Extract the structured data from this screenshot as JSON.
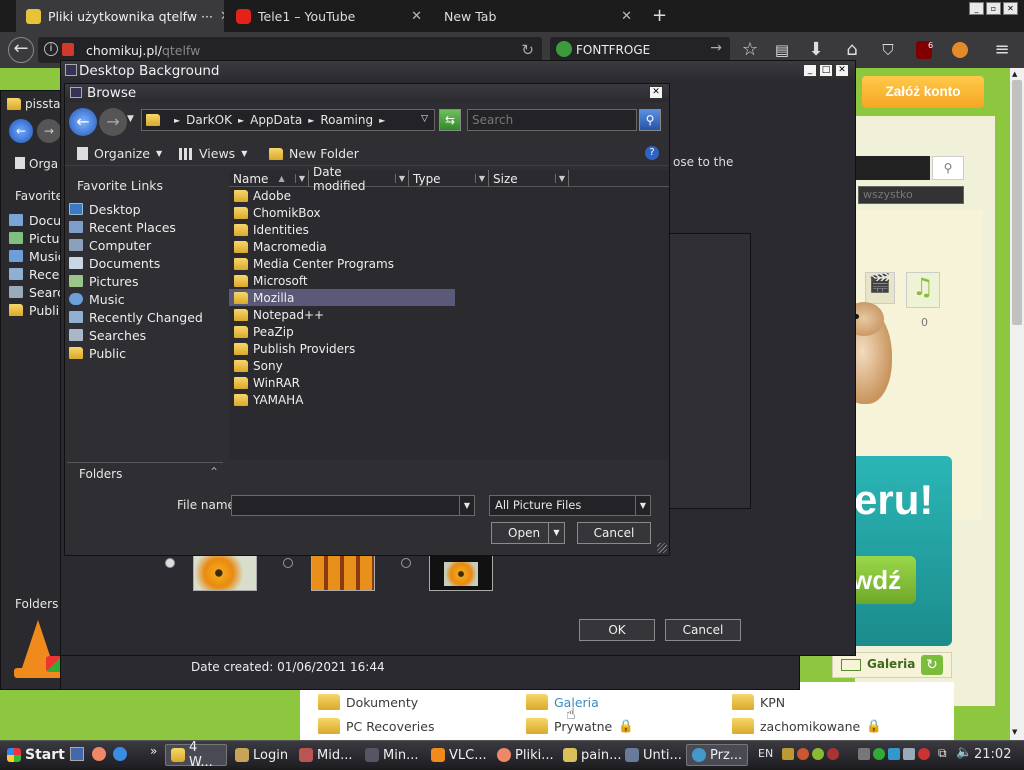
{
  "browser": {
    "tabs": [
      {
        "label": "Pliki użytkownika qtelfw ···",
        "close": "✕"
      },
      {
        "label": "Tele1 – YouTube",
        "close": "✕"
      },
      {
        "label": "New Tab",
        "close": "✕"
      }
    ],
    "new_tab": "+",
    "url_host": "chomikuj.pl/",
    "url_path": "qtelfw",
    "search_engine_text": "FONTFROGE",
    "ublock_count": "6"
  },
  "page": {
    "zaloz_konto": "Załóż konto",
    "search_filter": "wszystko",
    "hint_text": "ose to the",
    "film_count": "0",
    "banner_text": "eru!",
    "banner_button": "wdź",
    "galeria_label": "Galeria",
    "folders": [
      {
        "label": "Dokumenty"
      },
      {
        "label": "Galeria"
      },
      {
        "label": "KPN"
      },
      {
        "label": "PC Recoveries"
      },
      {
        "label": "Prywatne"
      },
      {
        "label": "zachomikowane"
      }
    ]
  },
  "explorer_bg": {
    "tab_label": "pissta",
    "sidebar_favorite": "Favorite",
    "items": [
      "Docu",
      "Pictu",
      "Music",
      "Rece",
      "Searc",
      "Publi"
    ],
    "folders_label": "Folders",
    "organize": "Orga"
  },
  "desktop_background": {
    "title": "Desktop Background",
    "ok": "OK",
    "cancel": "Cancel",
    "date_created": "Date created: 01/06/2021 16:44"
  },
  "browse": {
    "title": "Browse",
    "breadcrumb": [
      "DarkOK",
      "AppData",
      "Roaming"
    ],
    "search_placeholder": "Search",
    "toolbar": {
      "organize": "Organize",
      "views": "Views",
      "new_folder": "New Folder"
    },
    "favorite_links_title": "Favorite Links",
    "favorite_links": [
      "Desktop",
      "Recent Places",
      "Computer",
      "Documents",
      "Pictures",
      "Music",
      "Recently Changed",
      "Searches",
      "Public"
    ],
    "folders_pane": "Folders",
    "columns": [
      "Name",
      "Date modified",
      "Type",
      "Size"
    ],
    "files": [
      "Adobe",
      "ChomikBox",
      "Identities",
      "Macromedia",
      "Media Center Programs",
      "Microsoft",
      "Mozilla",
      "Notepad++",
      "PeaZip",
      "Publish Providers",
      "Sony",
      "WinRAR",
      "YAMAHA"
    ],
    "selected_index": 6,
    "file_name_label": "File name:",
    "file_name_value": "",
    "filter_value": "All Picture Files",
    "open": "Open",
    "cancel": "Cancel"
  },
  "taskbar": {
    "start": "Start",
    "group_label": "4 W...",
    "items": [
      "Login",
      "Mid...",
      "Min...",
      "VLC...",
      "Pliki...",
      "pain...",
      "Unti...",
      "Prz..."
    ],
    "lang": "EN",
    "clock": "21:02"
  },
  "colors": {
    "page_green": "#8dc63f",
    "orange_button": "#f5a623",
    "selection": "#5a5a78",
    "folder_yellow": "#f2c94c"
  }
}
